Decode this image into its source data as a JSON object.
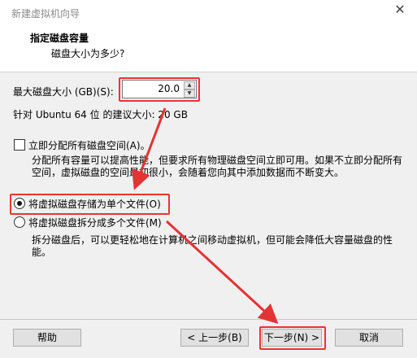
{
  "window": {
    "title": "新建虚拟机向导"
  },
  "header": {
    "title": "指定磁盘容量",
    "subtitle": "磁盘大小为多少?"
  },
  "disk": {
    "max_label": "最大磁盘大小 (GB)(S):",
    "max_value": "20.0",
    "recommended": "针对 Ubuntu 64 位 的建议大小: 20 GB"
  },
  "allocate": {
    "label": "立即分配所有磁盘空间(A)。",
    "checked": false,
    "description": "分配所有容量可以提高性能，但要求所有物理磁盘空间立即可用。如果不立即分配所有空间，虚拟磁盘的空间最初很小，会随着您向其中添加数据而不断变大。"
  },
  "storage_options": [
    {
      "label": "将虚拟磁盘存储为单个文件(O)",
      "selected": true
    },
    {
      "label": "将虚拟磁盘拆分成多个文件(M)",
      "selected": false
    }
  ],
  "split_description": "拆分磁盘后，可以更轻松地在计算机之间移动虚拟机，但可能会降低大容量磁盘的性能。",
  "buttons": {
    "help": "帮助",
    "back": "< 上一步(B)",
    "next": "下一步(N) >",
    "cancel": "取消"
  },
  "colors": {
    "highlight": "#e33333",
    "window_bg": "#f0f0f0"
  }
}
